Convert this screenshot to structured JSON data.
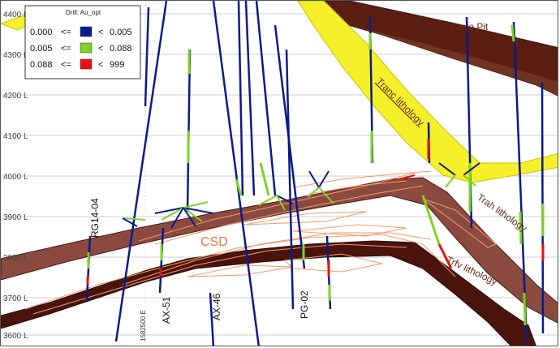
{
  "section": {
    "elevation_labels": [
      "4400 L",
      "4300 L",
      "4200 L",
      "4100 L",
      "4000 L",
      "3900 L",
      "3800 L",
      "3700 L",
      "3600 L"
    ],
    "easting_label": "1582500 E"
  },
  "legend": {
    "title": "Drill: Au_opt",
    "rows": [
      {
        "low": "0.000",
        "op1": "<=",
        "op2": "<",
        "high": "0.005",
        "color": "#0a1a8c"
      },
      {
        "low": "0.005",
        "op1": "<=",
        "op2": "<",
        "high": "0.088",
        "color": "#7ed321"
      },
      {
        "low": "0.088",
        "op1": "<=",
        "op2": "<",
        "high": "999",
        "color": "#e81010"
      }
    ]
  },
  "units": {
    "cove_pit": "Cove Pit",
    "tranc": "Tranc lithology",
    "trah": "Trah lithology",
    "trfv": "Trfv lithology",
    "csd": "CSD"
  },
  "holes": {
    "rg14": "RG14-04",
    "ax51": "AX-51",
    "ax46": "AX-46",
    "pg02": "PG-02"
  },
  "colors": {
    "tranc_fill": "#f5f02a",
    "dark_unit": "#5a1f12",
    "mid_unit": "#8b4a40",
    "contour": "#f29a6a",
    "low_grade": "#0a1a8c",
    "mid_grade": "#7ed321",
    "high_grade": "#e81010"
  }
}
